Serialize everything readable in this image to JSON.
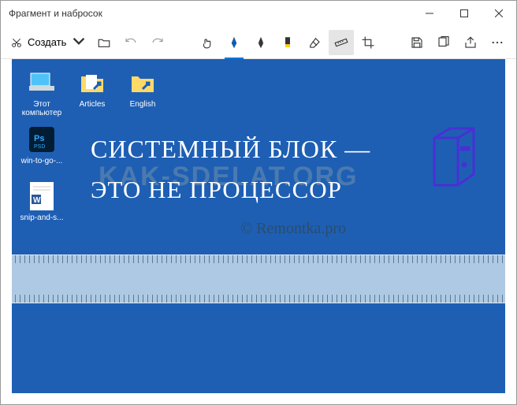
{
  "window": {
    "title": "Фрагмент и набросок"
  },
  "toolbar": {
    "create_label": "Создать"
  },
  "desktop": {
    "icons": [
      {
        "label": "Этот компьютер"
      },
      {
        "label": "Articles"
      },
      {
        "label": "English"
      },
      {
        "label": "win-to-go-..."
      },
      {
        "label": "snip-and-s..."
      }
    ]
  },
  "handwriting": {
    "line1": "СИСТЕМНЫЙ БЛОК —",
    "line2": "ЭТО НЕ ПРОЦЕССОР"
  },
  "watermark": "KAK-SDELAT.ORG",
  "signature": "© Remontka.pro",
  "colors": {
    "desktop_bg": "#1e5fb4",
    "accent": "#0078d4",
    "ink_purple": "#4a2fd4"
  }
}
